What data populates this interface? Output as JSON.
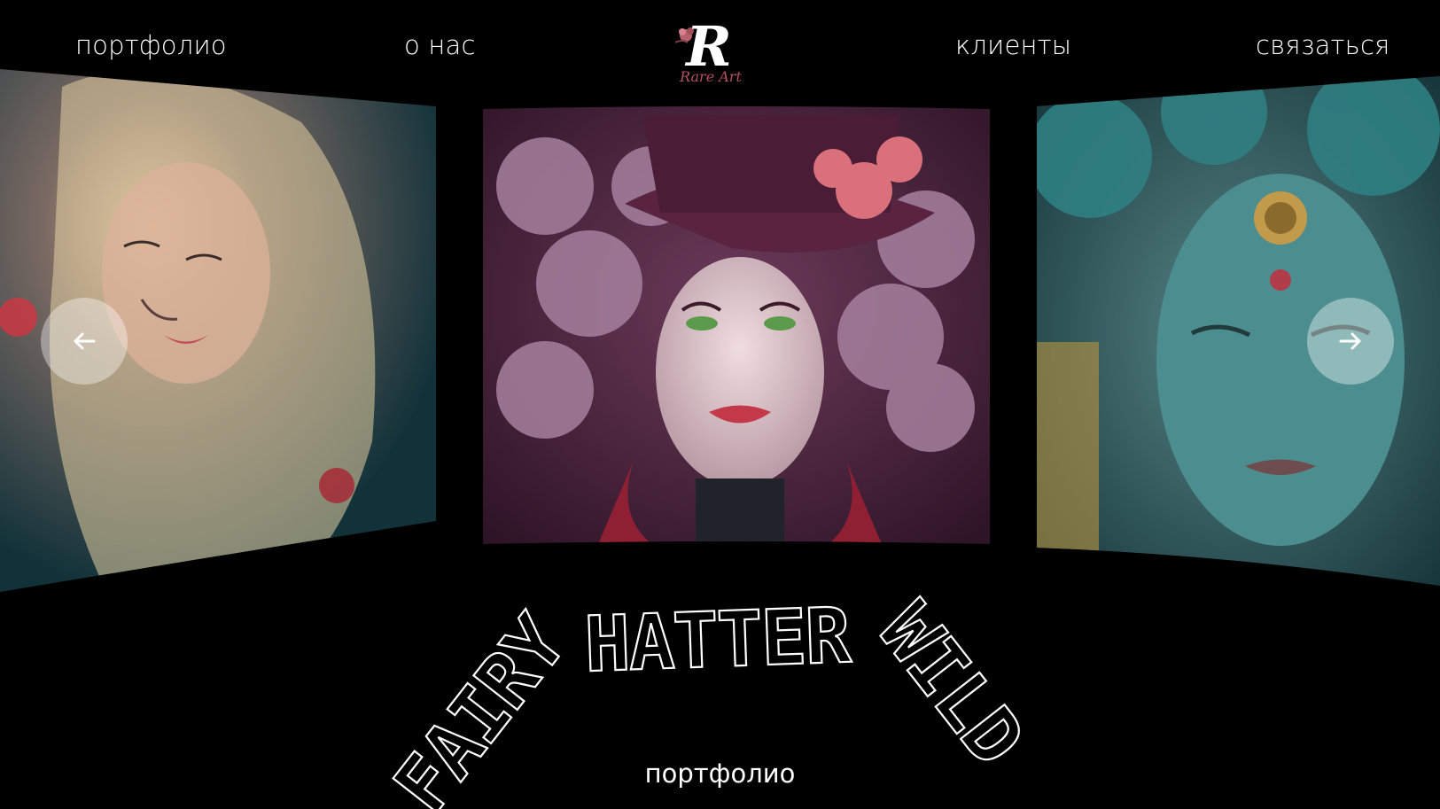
{
  "nav": {
    "portfolio": "портфолио",
    "about": "о нас",
    "clients": "клиенты",
    "contact": "связаться"
  },
  "logo": {
    "letter": "R",
    "wordmark": "Rare Art"
  },
  "carousel": {
    "prev_icon": "arrow-left-icon",
    "next_icon": "arrow-right-icon",
    "slides": [
      {
        "name": "left-slide",
        "palette": [
          "#1a3b45",
          "#e8d3a6",
          "#c7404e"
        ]
      },
      {
        "name": "center-slide",
        "palette": [
          "#3d1d34",
          "#b98aa8",
          "#d36d79"
        ]
      },
      {
        "name": "right-slide",
        "palette": [
          "#0f3b40",
          "#5ba3a4",
          "#c6a65a"
        ]
      }
    ]
  },
  "ring": {
    "words": [
      "FAIRY",
      "HATTER",
      "WILD"
    ]
  },
  "footer_label": "портфолио",
  "colors": {
    "background": "#000000",
    "text": "#ffffff",
    "button_bg": "rgba(255,255,255,0.38)"
  }
}
